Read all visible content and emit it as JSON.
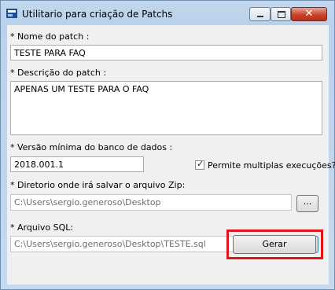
{
  "window": {
    "title": "Utilitario para criação de Patchs",
    "controls": {
      "minimize_icon": "minimize-icon",
      "maximize_icon": "maximize-icon",
      "close_icon": "close-icon",
      "close_glyph": "✕"
    }
  },
  "form": {
    "nome_label": "* Nome do patch :",
    "nome_value": "TESTE PARA FAQ",
    "descricao_label": "* Descrição do patch :",
    "descricao_value": "APENAS UM TESTE PARA O FAQ",
    "versao_label": "* Versão mínima do banco de dados :",
    "versao_value": "2018.001.1",
    "multiplas_label": "Permite multiplas execuções?",
    "multiplas_checked": true,
    "diretorio_label": "* Diretorio onde irá salvar o arquivo Zip:",
    "diretorio_value": "C:\\Users\\sergio.generoso\\Desktop",
    "diretorio_browse": "...",
    "sql_label": "* Arquivo SQL:",
    "sql_value": "C:\\Users\\sergio.generoso\\Desktop\\TESTE.sql",
    "sql_browse": "...",
    "gerar_label": "Gerar"
  },
  "colors": {
    "highlight": "#e0161d",
    "close_button": "#c8432d"
  }
}
